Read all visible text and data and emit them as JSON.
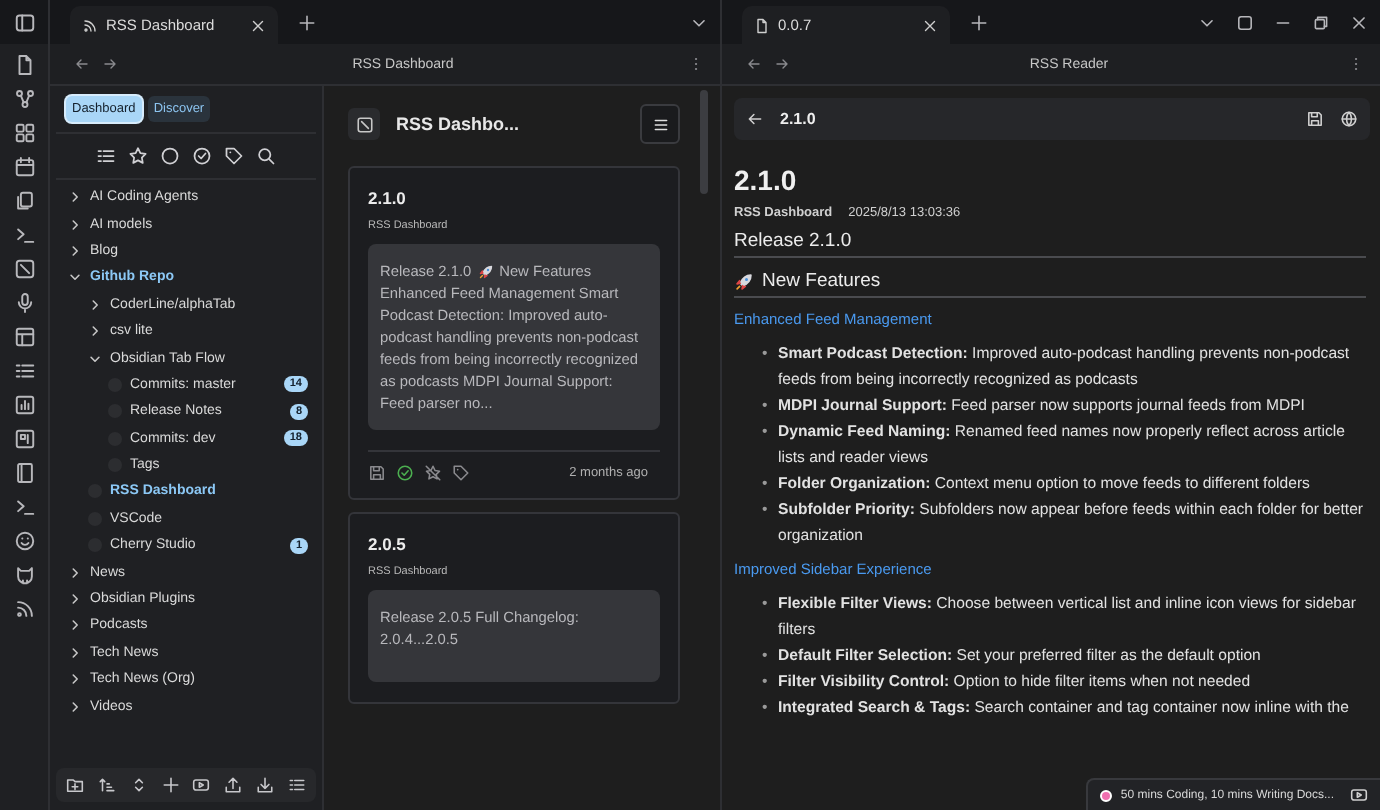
{
  "left_pane": {
    "tab": {
      "title": "RSS Dashboard"
    },
    "nav_title": "RSS Dashboard"
  },
  "sidebar": {
    "view_buttons": [
      {
        "label": "Dashboard",
        "selected": true
      },
      {
        "label": "Discover",
        "selected": false
      }
    ],
    "tree": [
      {
        "label": "AI Coding Agents",
        "kind": "folder",
        "expanded": false
      },
      {
        "label": "AI models",
        "kind": "folder",
        "expanded": false
      },
      {
        "label": "Blog",
        "kind": "folder",
        "expanded": false
      },
      {
        "label": "Github Repo",
        "kind": "folder",
        "expanded": true,
        "children": [
          {
            "label": "CoderLine/alphaTab",
            "kind": "folder",
            "expanded": false
          },
          {
            "label": "csv lite",
            "kind": "folder",
            "expanded": false
          },
          {
            "label": "Obsidian Tab Flow",
            "kind": "folder",
            "expanded": true,
            "children": [
              {
                "label": "Commits: master",
                "kind": "feed",
                "selected": false,
                "count": "14"
              },
              {
                "label": "Release Notes",
                "kind": "feed",
                "selected": false,
                "count": "8"
              },
              {
                "label": "Commits: dev",
                "kind": "feed",
                "selected": false,
                "count": "18"
              },
              {
                "label": "Tags",
                "kind": "feed",
                "selected": false
              }
            ]
          },
          {
            "label": "RSS Dashboard",
            "kind": "feed",
            "selected": true
          },
          {
            "label": "VSCode",
            "kind": "feed",
            "selected": false
          },
          {
            "label": "Cherry Studio",
            "kind": "feed",
            "selected": false,
            "count": "1"
          }
        ]
      },
      {
        "label": "News",
        "kind": "folder",
        "expanded": false
      },
      {
        "label": "Obsidian Plugins",
        "kind": "folder",
        "expanded": false
      },
      {
        "label": "Podcasts",
        "kind": "folder",
        "expanded": false
      },
      {
        "label": "Tech News",
        "kind": "folder",
        "expanded": false
      },
      {
        "label": "Tech News (Org)",
        "kind": "folder",
        "expanded": false
      },
      {
        "label": "Videos",
        "kind": "folder",
        "expanded": false
      }
    ]
  },
  "article_list": {
    "title": "RSS Dashbo...",
    "articles": [
      {
        "title": "2.1.0",
        "feed": "RSS Dashboard",
        "excerpt": [
          "Release 2.1.0",
          "New Features",
          "Enhanced Feed Management Smart Podcast Detection: Improved auto-podcast handling prevents non-podcast feeds from being incorrectly recognized as podcasts MDPI Journal Support: Feed parser no..."
        ],
        "read": true,
        "time": "2 months ago"
      },
      {
        "title": "2.0.5",
        "feed": "RSS Dashboard",
        "excerpt": [
          "Release 2.0.5 Full Changelog: 2.0.4...2.0.5"
        ]
      }
    ]
  },
  "right_pane": {
    "tab": {
      "title": "0.0.7"
    },
    "nav_title": "RSS Reader",
    "reader_title": "2.1.0",
    "article": {
      "title": "2.1.0",
      "feed": "RSS Dashboard",
      "date": "2025/8/13 13:03:36",
      "heading": "Release 2.1.0",
      "section": "New Features",
      "subsections": [
        {
          "title": "Enhanced Feed Management",
          "items": [
            {
              "marker": "•",
              "text": "**Smart Podcast Detection:** Improved auto-podcast handling prevents non-podcast feeds from being incorrectly recognized as podcasts"
            },
            {
              "marker": "•",
              "text": "**MDPI Journal Support:** Feed parser now supports journal feeds from MDPI"
            },
            {
              "marker": "•",
              "text": "**Dynamic Feed Naming:** Renamed feed names now properly reflect across article lists and reader views"
            },
            {
              "marker": "•",
              "text": "**Folder Organization:** Context menu option to move feeds to different folders"
            },
            {
              "marker": "•",
              "text": "**Subfolder Priority:** Subfolders now appear before feeds within each folder for better organization"
            }
          ]
        },
        {
          "title": "Improved Sidebar Experience",
          "items": [
            {
              "marker": "•",
              "text": "**Flexible Filter Views:** Choose between vertical list and inline icon views for sidebar filters"
            },
            {
              "marker": "•",
              "text": "**Default Filter Selection:** Set your preferred filter as the default option"
            },
            {
              "marker": "•",
              "text": "**Filter Visibility Control:** Option to hide filter items when not needed"
            },
            {
              "marker": "•",
              "text": "**Integrated Search & Tags:** Search container and tag container now inline with the"
            }
          ]
        }
      ]
    }
  },
  "status_bar": {
    "text": "50 mins Coding, 10 mins Writing Docs..."
  }
}
